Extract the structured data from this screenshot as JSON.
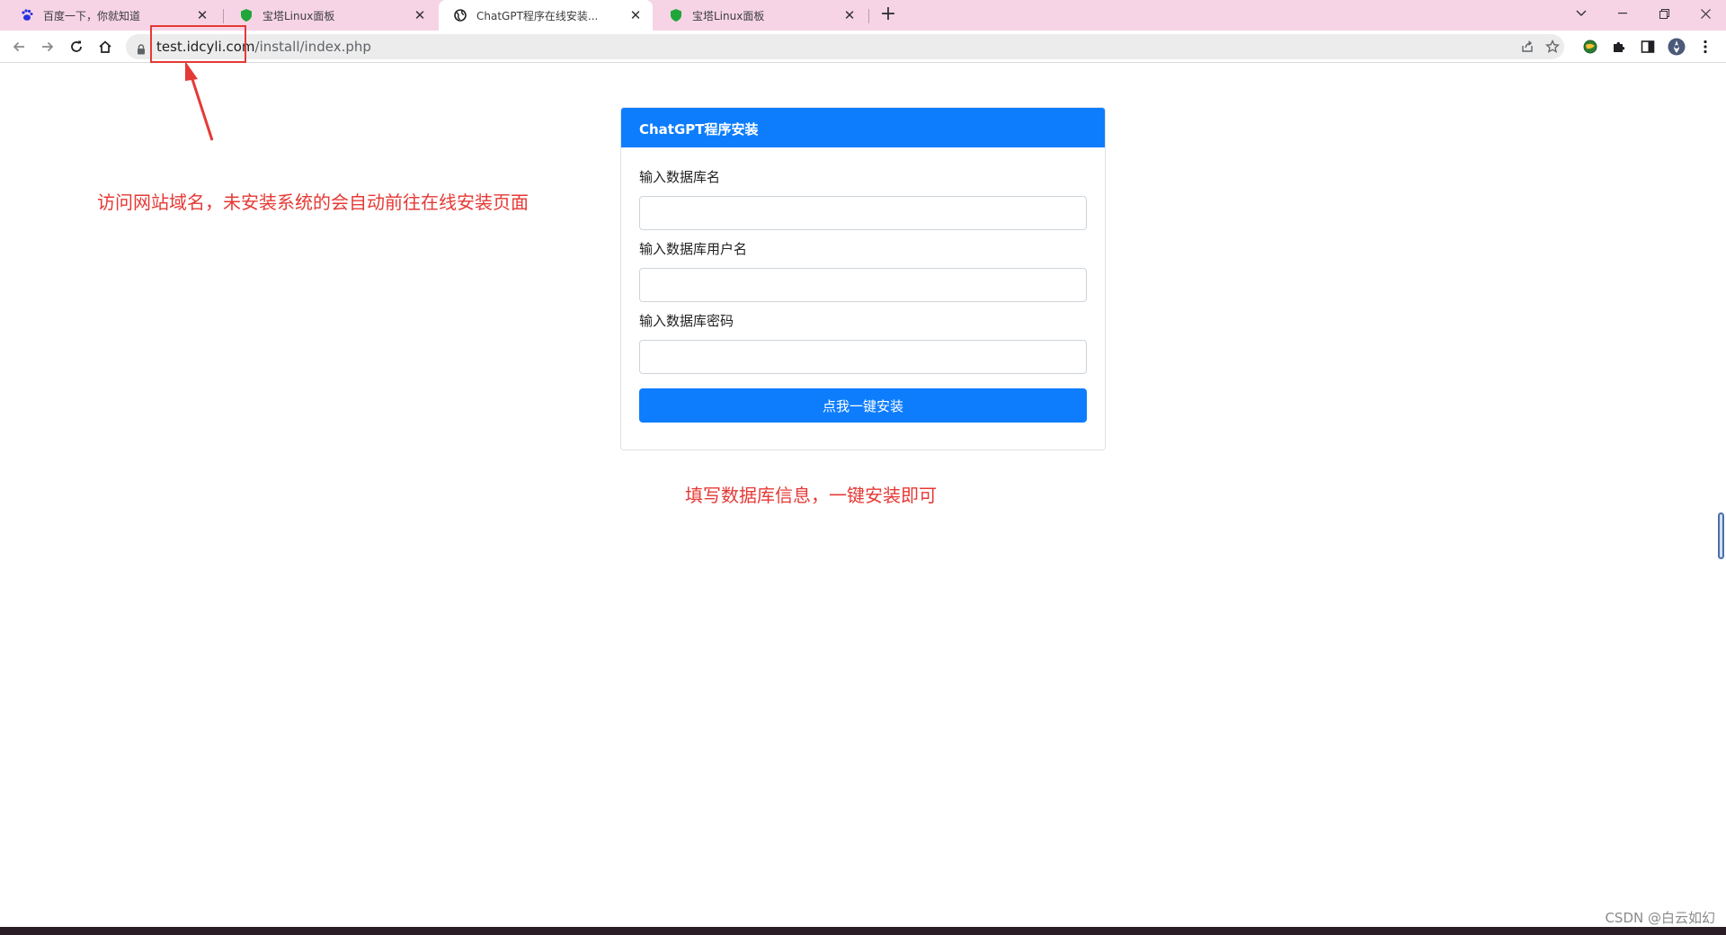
{
  "browser": {
    "tabs": [
      {
        "title": "百度一下，你就知道",
        "favicon": "baidu-paw-icon",
        "active": false
      },
      {
        "title": "宝塔Linux面板",
        "favicon": "baota-shield-icon",
        "active": false
      },
      {
        "title": "ChatGPT程序在线安装...",
        "favicon": "globe-icon",
        "active": true
      },
      {
        "title": "宝塔Linux面板",
        "favicon": "baota-shield-icon",
        "active": false
      }
    ],
    "new_tab_label": "+",
    "address": {
      "host": "test.idcyli.com",
      "path": "/install/index.php"
    }
  },
  "install_form": {
    "header": "ChatGPT程序安装",
    "fields": [
      {
        "label": "输入数据库名",
        "value": "",
        "placeholder": ""
      },
      {
        "label": "输入数据库用户名",
        "value": "",
        "placeholder": ""
      },
      {
        "label": "输入数据库密码",
        "value": "",
        "placeholder": ""
      }
    ],
    "submit_label": "点我一键安装"
  },
  "annotations": {
    "url_note": "访问网站域名，未安装系统的会自动前往在线安装页面",
    "form_note": "填写数据库信息，一键安装即可",
    "color": "#e53935"
  },
  "watermark": "CSDN @白云如幻",
  "colors": {
    "tabstrip": "#f6d4e6",
    "primary": "#0d7dfe"
  }
}
